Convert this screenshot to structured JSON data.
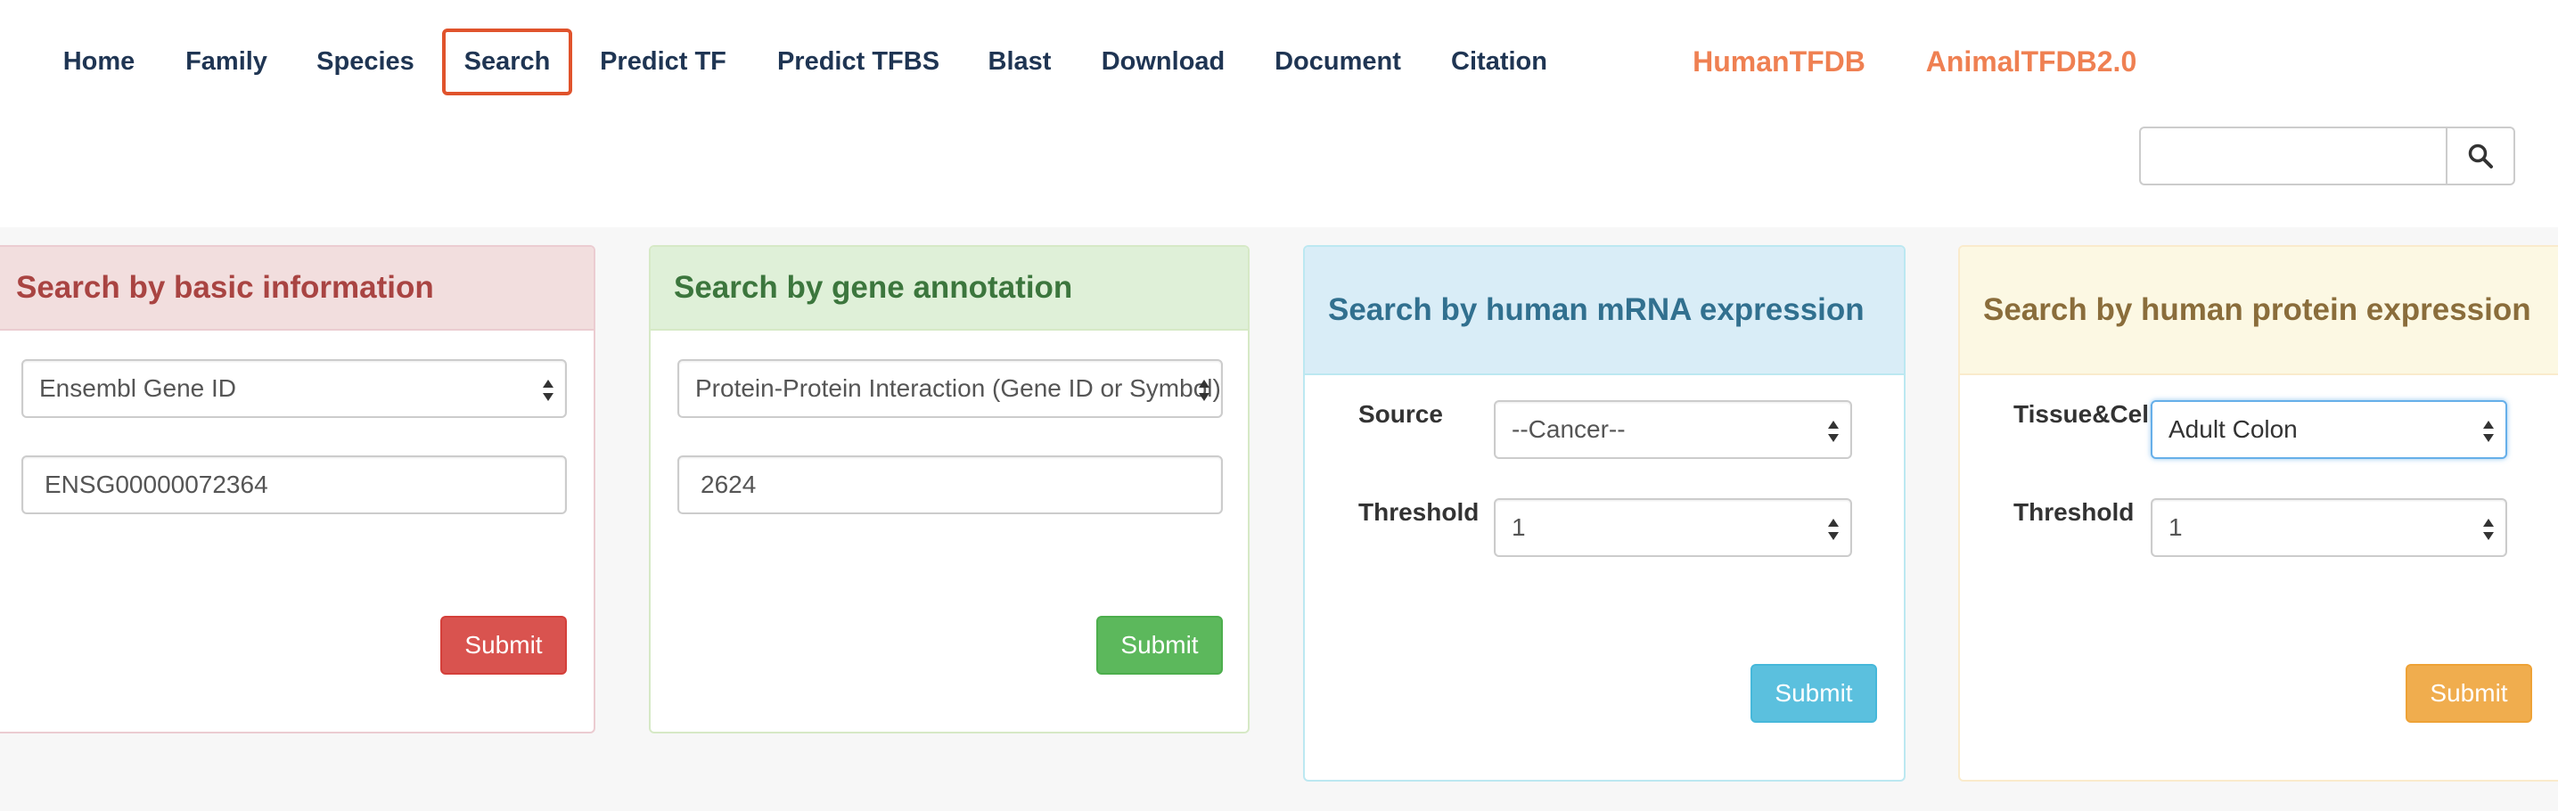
{
  "nav": {
    "items": [
      {
        "label": "Home"
      },
      {
        "label": "Family"
      },
      {
        "label": "Species"
      },
      {
        "label": "Search",
        "active": true
      },
      {
        "label": "Predict TF"
      },
      {
        "label": "Predict TFBS"
      },
      {
        "label": "Blast"
      },
      {
        "label": "Download"
      },
      {
        "label": "Document"
      },
      {
        "label": "Citation"
      }
    ],
    "external": [
      {
        "label": "HumanTFDB"
      },
      {
        "label": "AnimalTFDB2.0"
      }
    ],
    "search": {
      "value": "",
      "placeholder": "",
      "icon": "search-icon"
    }
  },
  "panels": {
    "basic": {
      "title": "Search by basic information",
      "select_value": "Ensembl Gene ID",
      "input_value": "ENSG00000072364",
      "submit_label": "Submit"
    },
    "annotation": {
      "title": "Search by gene annotation",
      "select_value": "Protein-Protein Interaction (Gene ID or Symbol)",
      "input_value": "2624",
      "submit_label": "Submit"
    },
    "mrna": {
      "title": "Search by human mRNA expression",
      "source_label": "Source",
      "source_value": "--Cancer--",
      "threshold_label": "Threshold",
      "threshold_value": "1",
      "submit_label": "Submit"
    },
    "protein": {
      "title": "Search by human protein expression",
      "tissue_label": "Tissue&Cell",
      "tissue_value": "Adult Colon",
      "threshold_label": "Threshold",
      "threshold_value": "1",
      "submit_label": "Submit"
    }
  },
  "colors": {
    "nav_text": "#1f3553",
    "external_link": "#ef8052",
    "active_border": "#e0532c",
    "danger": "#d9534f",
    "success": "#5cb85c",
    "info": "#5bc0de",
    "warning": "#f0ad4e"
  }
}
